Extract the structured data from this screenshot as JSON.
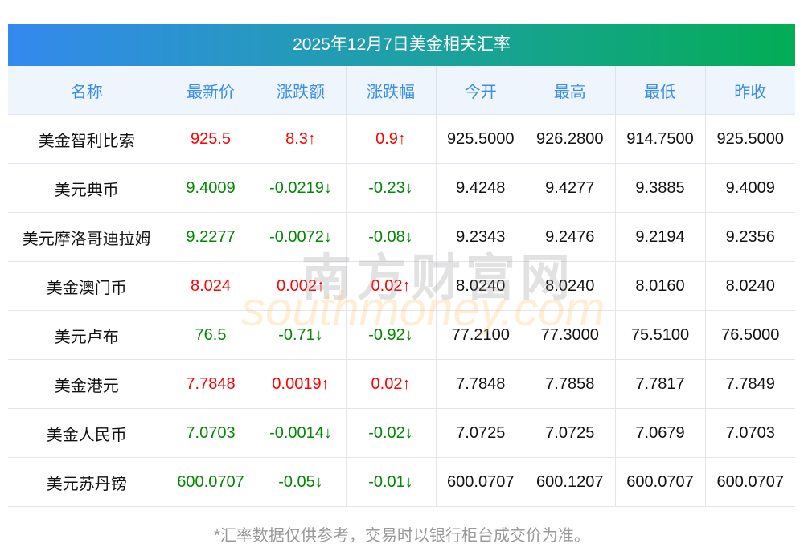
{
  "title": "2025年12月7日美金相关汇率",
  "headers": [
    "名称",
    "最新价",
    "涨跌额",
    "涨跌幅",
    "今开",
    "最高",
    "最低",
    "昨收"
  ],
  "rows": [
    {
      "name": "美金智利比索",
      "latest": "925.5",
      "change": "8.3↑",
      "pct": "0.9↑",
      "open": "925.5000",
      "high": "926.2800",
      "low": "914.7500",
      "prev": "925.5000",
      "dir": "up"
    },
    {
      "name": "美元典币",
      "latest": "9.4009",
      "change": "-0.0219↓",
      "pct": "-0.23↓",
      "open": "9.4248",
      "high": "9.4277",
      "low": "9.3885",
      "prev": "9.4009",
      "dir": "down"
    },
    {
      "name": "美元摩洛哥迪拉姆",
      "latest": "9.2277",
      "change": "-0.0072↓",
      "pct": "-0.08↓",
      "open": "9.2343",
      "high": "9.2476",
      "low": "9.2194",
      "prev": "9.2356",
      "dir": "down"
    },
    {
      "name": "美金澳门币",
      "latest": "8.024",
      "change": "0.002↑",
      "pct": "0.02↑",
      "open": "8.0240",
      "high": "8.0240",
      "low": "8.0160",
      "prev": "8.0240",
      "dir": "up"
    },
    {
      "name": "美元卢布",
      "latest": "76.5",
      "change": "-0.71↓",
      "pct": "-0.92↓",
      "open": "77.2100",
      "high": "77.3000",
      "low": "75.5100",
      "prev": "76.5000",
      "dir": "down"
    },
    {
      "name": "美金港元",
      "latest": "7.7848",
      "change": "0.0019↑",
      "pct": "0.02↑",
      "open": "7.7848",
      "high": "7.7858",
      "low": "7.7817",
      "prev": "7.7849",
      "dir": "up"
    },
    {
      "name": "美金人民币",
      "latest": "7.0703",
      "change": "-0.0014↓",
      "pct": "-0.02↓",
      "open": "7.0725",
      "high": "7.0725",
      "low": "7.0679",
      "prev": "7.0703",
      "dir": "down"
    },
    {
      "name": "美元苏丹镑",
      "latest": "600.0707",
      "change": "-0.05↓",
      "pct": "-0.01↓",
      "open": "600.0707",
      "high": "600.1207",
      "low": "600.0707",
      "prev": "600.0707",
      "dir": "down"
    }
  ],
  "footer": "*汇率数据仅供参考，交易时以银行柜台成交价为准。",
  "watermark": {
    "cn": "南方财富网",
    "en": "southmoney.com"
  },
  "colors": {
    "up": "#ff0000",
    "down": "#008800",
    "header_text": "#3a8ee6"
  }
}
